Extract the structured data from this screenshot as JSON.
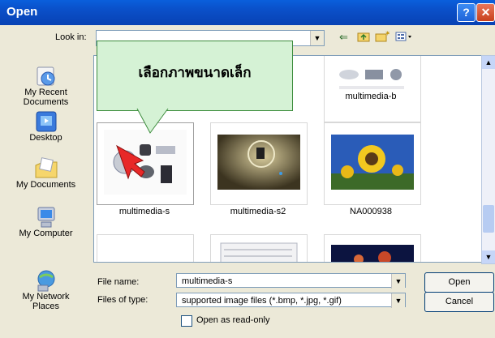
{
  "window": {
    "title": "Open"
  },
  "titlebar": {
    "help": "?",
    "close": "✕"
  },
  "toolbar": {
    "look_in_label": "Look in:",
    "look_in_value": ""
  },
  "places": [
    {
      "label1": "My Recent",
      "label2": "Documents",
      "icon": "recent-documents-icon"
    },
    {
      "label1": "Desktop",
      "label2": "",
      "icon": "desktop-icon"
    },
    {
      "label1": "My Documents",
      "label2": "",
      "icon": "my-documents-icon"
    },
    {
      "label1": "My Computer",
      "label2": "",
      "icon": "my-computer-icon"
    },
    {
      "label1": "My Network",
      "label2": "Places",
      "icon": "network-places-icon"
    }
  ],
  "files": [
    {
      "name": "multimedia-b"
    },
    {
      "name": "multimedia-s",
      "selected": true
    },
    {
      "name": "multimedia-s2"
    },
    {
      "name": "NA000938"
    }
  ],
  "callout": {
    "text": "เลือกภาพขนาดเล็ก"
  },
  "form": {
    "file_name_label": "File name:",
    "file_name_value": "multimedia-s",
    "file_type_label": "Files of type:",
    "file_type_value": "supported image files (*.bmp, *.jpg, *.gif)",
    "readonly_label": "Open as read-only"
  },
  "buttons": {
    "open": "Open",
    "cancel": "Cancel"
  },
  "colors": {
    "titlebar": "#0A4FC8",
    "dialog": "#ECE9D8",
    "callout": "#D5F2D5"
  }
}
